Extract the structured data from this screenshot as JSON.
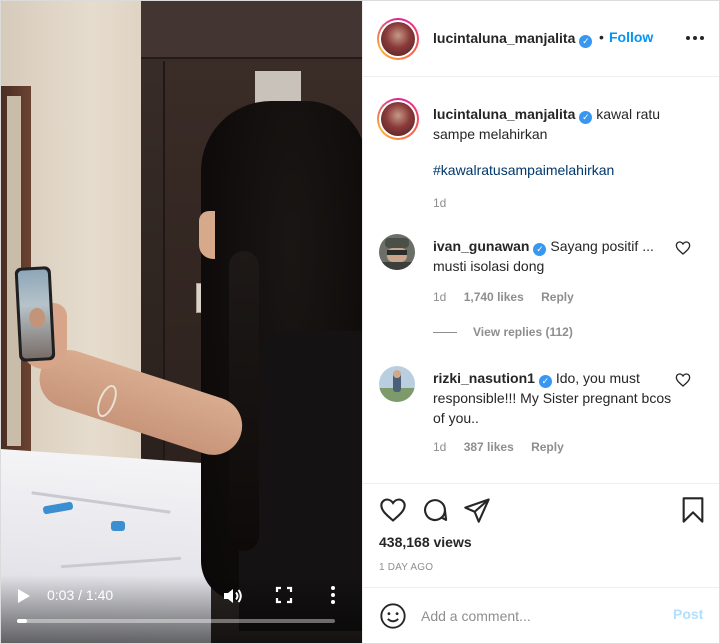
{
  "post": {
    "username": "lucintaluna_manjalita",
    "follow_label": "Follow",
    "separator": "•"
  },
  "caption": {
    "username": "lucintaluna_manjalita",
    "text": "kawal ratu sampe melahirkan",
    "hashtag": "#kawalratusampaimelahirkan",
    "time": "1d"
  },
  "comments": [
    {
      "username": "ivan_gunawan",
      "text": "Sayang positif ... musti isolasi dong",
      "time": "1d",
      "likes": "1,740 likes",
      "reply": "Reply",
      "view_replies": "View replies (112)"
    },
    {
      "username": "rizki_nasution1",
      "text": "Ido, you must responsible!!! My Sister pregnant bcos of you..",
      "time": "1d",
      "likes": "387 likes",
      "reply": "Reply"
    }
  ],
  "video": {
    "time": "0:03 / 1:40",
    "progress": 0.03
  },
  "stats": {
    "views": "438,168 views",
    "posted": "1 DAY AGO"
  },
  "comment_box": {
    "placeholder": "Add a comment...",
    "post_label": "Post"
  },
  "icons": {
    "verified": "verified-badge-icon",
    "more": "more-horizontal-icon",
    "like": "heart-icon",
    "comment": "comment-bubble-icon",
    "share": "paper-plane-icon",
    "save": "bookmark-icon",
    "emoji": "smiley-icon",
    "play": "play-icon",
    "volume": "volume-icon",
    "fullscreen": "fullscreen-icon"
  },
  "colors": {
    "link": "#0095f6",
    "hashtag": "#00376b",
    "muted": "#8e8e8e",
    "verified": "#3897f0",
    "post_disabled": "#b2dffc"
  }
}
